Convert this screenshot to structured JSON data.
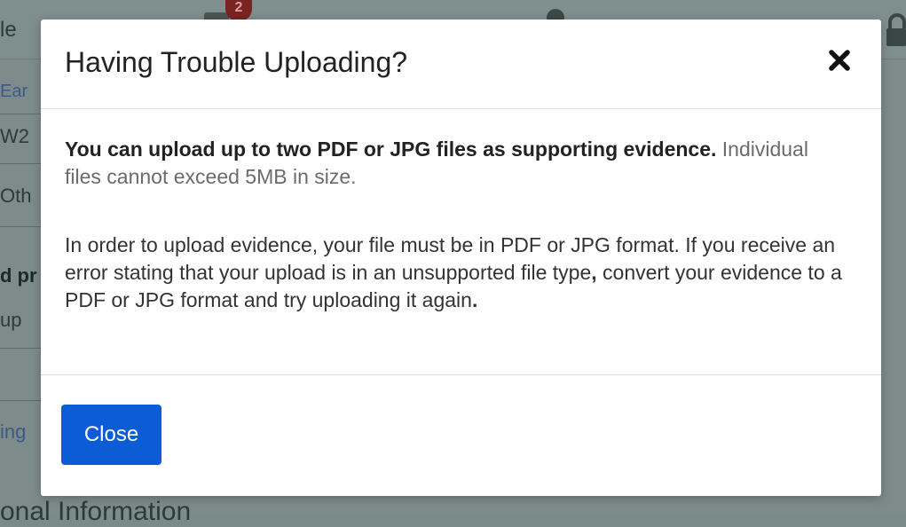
{
  "background": {
    "top_fragment": "le",
    "badge_count": "2",
    "rows": [
      "Ear",
      "W2",
      "Oth",
      "d pr",
      "up",
      "ing"
    ],
    "bottom_heading": "onal Information"
  },
  "modal": {
    "title": "Having Trouble Uploading?",
    "close_icon": "close-x-icon",
    "body": {
      "intro_bold": "You can upload up to two PDF or JPG files as supporting evidence.",
      "intro_muted": "Individual files cannot exceed 5MB in size.",
      "details_part1": "In order to upload evidence, your file must be in PDF or JPG format. If you receive an error stating that your upload is in an unsupported file type",
      "details_comma": ",",
      "details_part2": " convert your evidence to a PDF or JPG format and try uploading it again",
      "details_period": "."
    },
    "footer": {
      "close_label": "Close"
    }
  },
  "colors": {
    "primary_button": "#0b5cd5",
    "overlay": "#7d8c8b"
  }
}
